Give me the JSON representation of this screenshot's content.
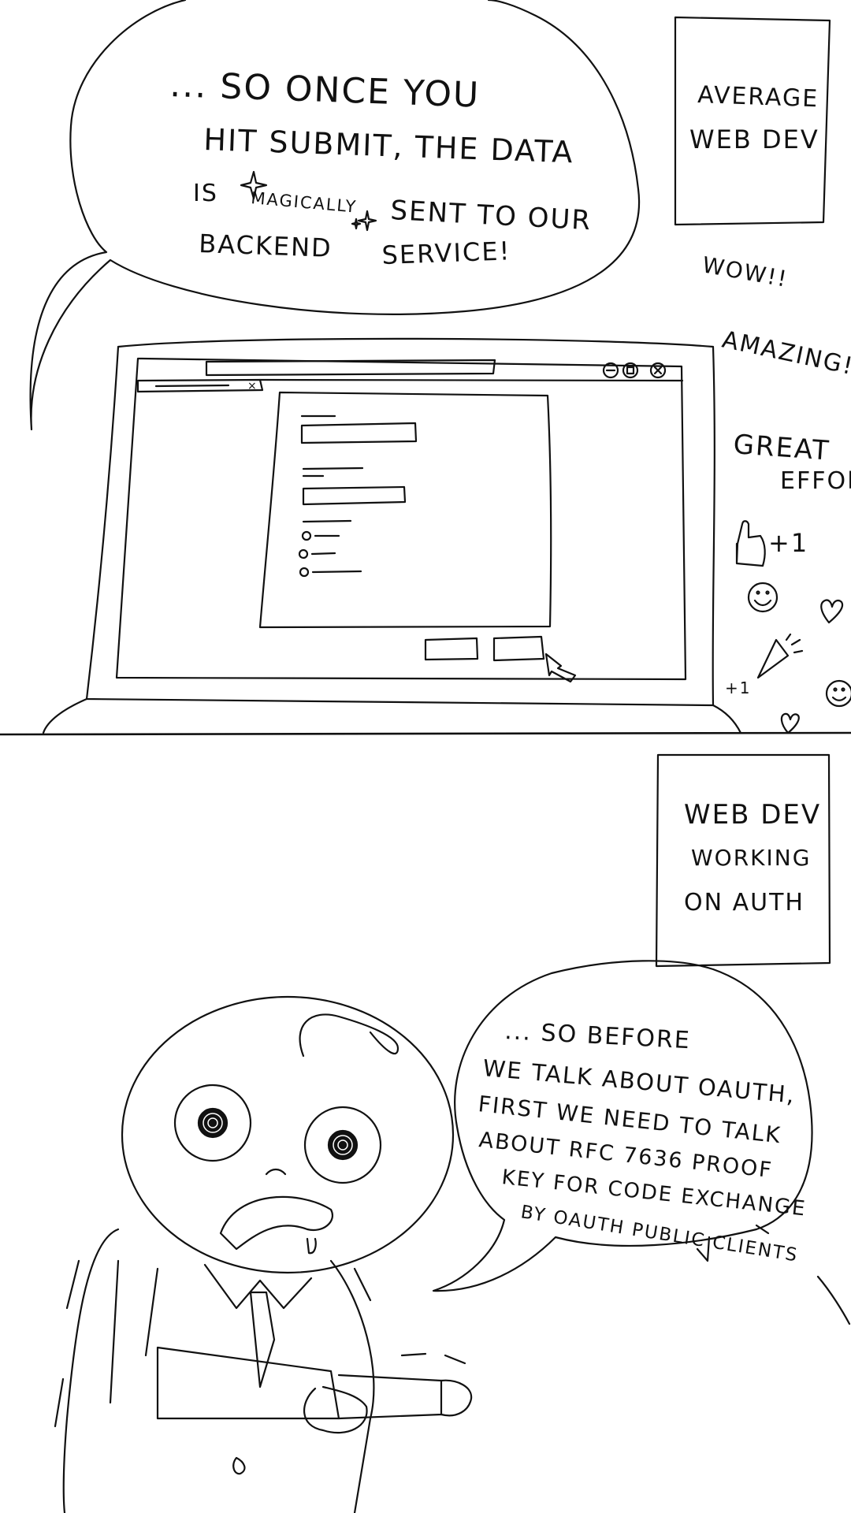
{
  "panel1": {
    "speech": [
      "... SO ONCE YOU",
      "HIT SUBMIT, THE DATA",
      "IS",
      "MAGICALLY",
      "SENT TO OUR",
      "BACKEND",
      "SERVICE!"
    ],
    "caption": [
      "AVERAGE",
      "WEB DEV"
    ],
    "reactions": [
      "WOW!!",
      "AMAZING!",
      "GREAT",
      "EFFOR",
      "+1",
      "+1"
    ],
    "reaction_icons": [
      "thumbs-up-icon",
      "smiley-icon",
      "heart-icon",
      "party-popper-icon",
      "smiley-icon",
      "heart-icon"
    ],
    "laptop_browser": {
      "tab_close": "×",
      "window_controls": [
        "−",
        "□",
        "×"
      ]
    }
  },
  "panel2": {
    "caption": [
      "WEB DEV",
      "WORKING",
      "ON AUTH"
    ],
    "speech": [
      "... SO BEFORE",
      "WE TALK ABOUT OAUTH,",
      "FIRST WE NEED TO TALK",
      "ABOUT RFC 7636 PROOF",
      "KEY FOR CODE EXCHANGE",
      "BY OAUTH PUBLIC CLIENTS"
    ]
  }
}
